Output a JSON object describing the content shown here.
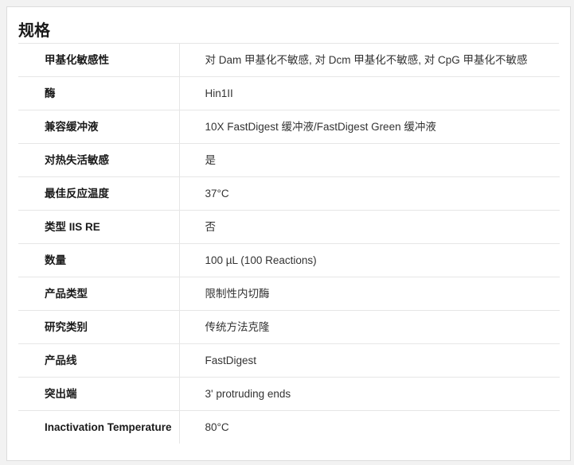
{
  "section": {
    "title": "规格"
  },
  "specs": [
    {
      "label": "甲基化敏感性",
      "value": "对 Dam 甲基化不敏感, 对 Dcm 甲基化不敏感, 对 CpG 甲基化不敏感"
    },
    {
      "label": "酶",
      "value": "Hin1II"
    },
    {
      "label": "兼容缓冲液",
      "value": "10X FastDigest 缓冲液/FastDigest Green 缓冲液"
    },
    {
      "label": "对热失活敏感",
      "value": "是"
    },
    {
      "label": "最佳反应温度",
      "value": "37°C"
    },
    {
      "label": "类型 IIS RE",
      "value": "否"
    },
    {
      "label": "数量",
      "value": "100 µL (100 Reactions)"
    },
    {
      "label": "产品类型",
      "value": "限制性内切酶"
    },
    {
      "label": "研究类别",
      "value": "传统方法克隆"
    },
    {
      "label": "产品线",
      "value": "FastDigest"
    },
    {
      "label": "突出端",
      "value": "3' protruding ends"
    },
    {
      "label": "Inactivation Temperature",
      "value": "80°C"
    }
  ]
}
